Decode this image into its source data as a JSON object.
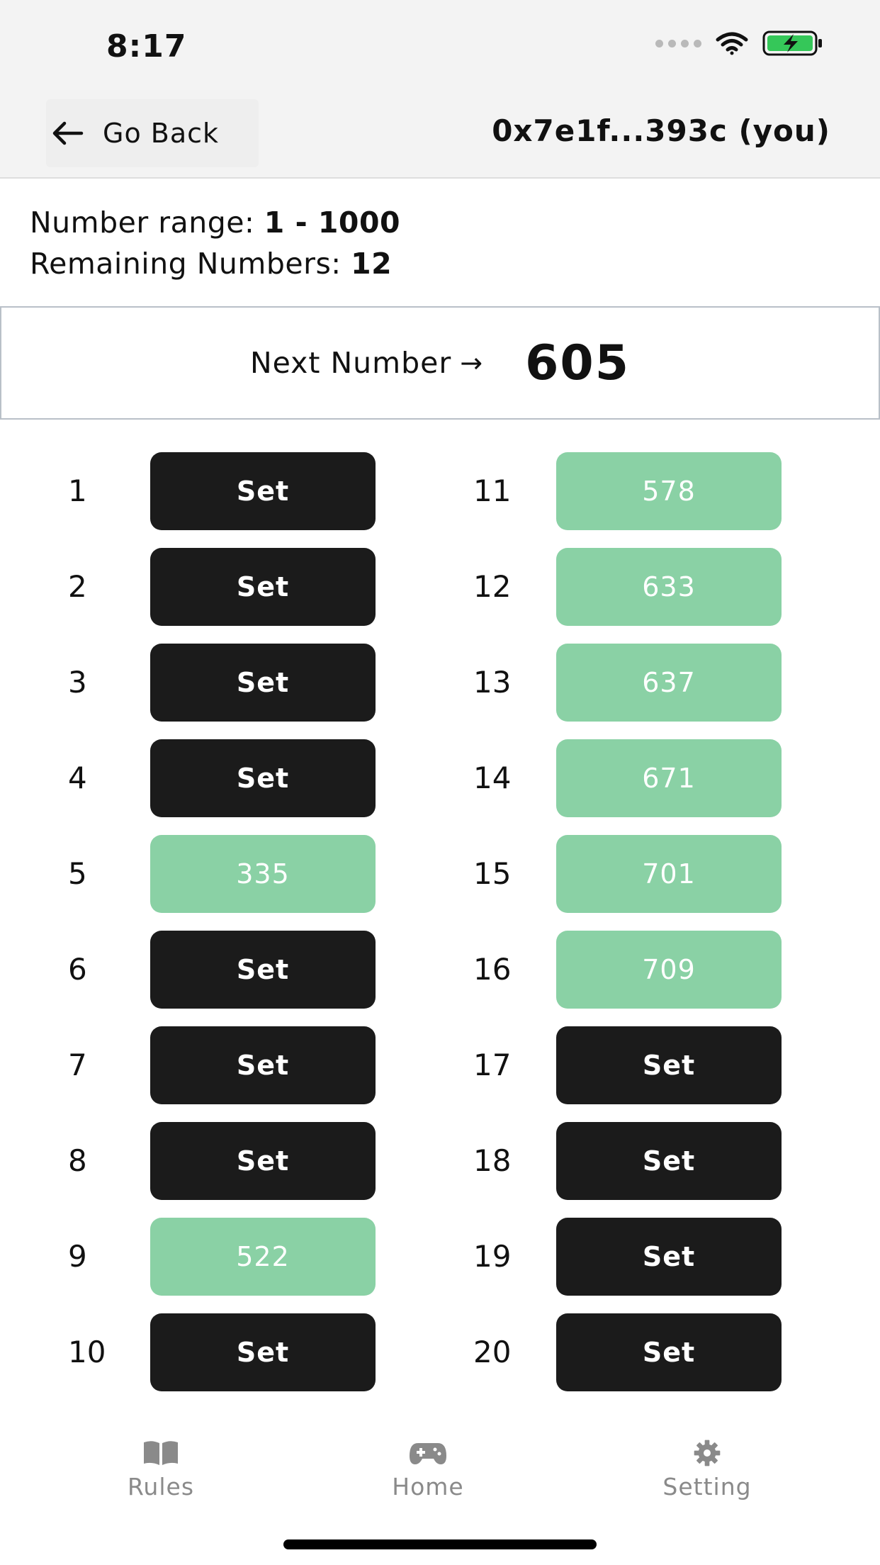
{
  "status_bar": {
    "time": "8:17"
  },
  "header": {
    "back_label": "Go Back",
    "account_label": "0x7e1f...393c (you)"
  },
  "info": {
    "range_label": "Number range: ",
    "range_value": "1 - 1000",
    "remaining_label": "Remaining Numbers: ",
    "remaining_value": "12"
  },
  "next_number": {
    "label": "Next Number",
    "arrow": "→",
    "value": "605"
  },
  "slots": [
    {
      "index": "1",
      "value": "Set",
      "state": "empty"
    },
    {
      "index": "2",
      "value": "Set",
      "state": "empty"
    },
    {
      "index": "3",
      "value": "Set",
      "state": "empty"
    },
    {
      "index": "4",
      "value": "Set",
      "state": "empty"
    },
    {
      "index": "5",
      "value": "335",
      "state": "filled"
    },
    {
      "index": "6",
      "value": "Set",
      "state": "empty"
    },
    {
      "index": "7",
      "value": "Set",
      "state": "empty"
    },
    {
      "index": "8",
      "value": "Set",
      "state": "empty"
    },
    {
      "index": "9",
      "value": "522",
      "state": "filled"
    },
    {
      "index": "10",
      "value": "Set",
      "state": "empty"
    },
    {
      "index": "11",
      "value": "578",
      "state": "filled"
    },
    {
      "index": "12",
      "value": "633",
      "state": "filled"
    },
    {
      "index": "13",
      "value": "637",
      "state": "filled"
    },
    {
      "index": "14",
      "value": "671",
      "state": "filled"
    },
    {
      "index": "15",
      "value": "701",
      "state": "filled"
    },
    {
      "index": "16",
      "value": "709",
      "state": "filled"
    },
    {
      "index": "17",
      "value": "Set",
      "state": "empty"
    },
    {
      "index": "18",
      "value": "Set",
      "state": "empty"
    },
    {
      "index": "19",
      "value": "Set",
      "state": "empty"
    },
    {
      "index": "20",
      "value": "Set",
      "state": "empty"
    }
  ],
  "tabs": [
    {
      "label": "Rules",
      "icon": "book-icon"
    },
    {
      "label": "Home",
      "icon": "gamepad-icon"
    },
    {
      "label": "Setting",
      "icon": "gear-icon"
    }
  ],
  "colors": {
    "set_button": "#1b1b1b",
    "filled_slot": "#8ad1a5",
    "tab_inactive": "#8a8a8a"
  }
}
